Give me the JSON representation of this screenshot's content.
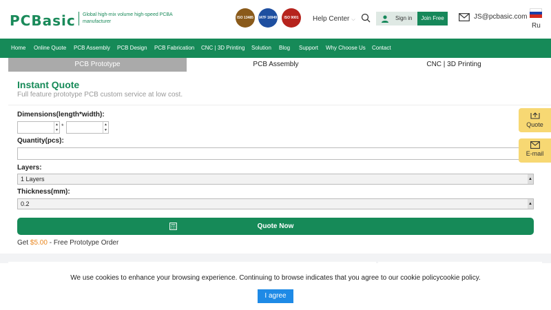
{
  "header": {
    "logo_text": "PCBasic",
    "tagline": "Global high-mix volume high-speed PCBA manufacturer",
    "certs": [
      {
        "label": "ISO 13485",
        "color": "#8a5a1a"
      },
      {
        "label": "IATF 16949",
        "color": "#1e4fa0"
      },
      {
        "label": "ISO 9001",
        "color": "#b6231d"
      }
    ],
    "help_center": "Help Center",
    "sign_in": "Sign in",
    "join_free": "Join Free",
    "email": "JS@pcbasic.com",
    "language": "Ru"
  },
  "nav": {
    "items": [
      "Home",
      "Online Quote",
      "PCB Assembly",
      "PCB Design",
      "PCB Fabrication",
      "CNC | 3D Printing",
      "Solution",
      "Blog",
      "Support",
      "Why Choose Us",
      "Contact"
    ]
  },
  "tabs": [
    "PCB Prototype",
    "PCB Assembly",
    "CNC | 3D Printing"
  ],
  "form": {
    "title": "Instant Quote",
    "subtitle": "Full feature prototype PCB custom service at low cost.",
    "dimensions_label": "Dimensions(length*width):",
    "dimension_separator": "*",
    "quantity_label": "Quantity(pcs):",
    "layers_label": "Layers:",
    "layers_value": "1 Layers",
    "thickness_label": "Thickness(mm):",
    "thickness_value": "0.2",
    "submit_label": "Quote Now",
    "promo_prefix": "Get",
    "promo_price": "$5.00",
    "promo_suffix": "- Free Prototype Order"
  },
  "side": {
    "quote_label": "Quote",
    "email_label": "E-mail"
  },
  "cookie": {
    "text": "We use cookies to enhance your browsing experience. Continuing to browse indicates that you agree to our cookie policycookie policy.",
    "agree_label": "I agree"
  },
  "colors": {
    "brand_green": "#168a58",
    "accent_yellow": "#f7d873",
    "price_orange": "#e9861e",
    "agree_blue": "#1e8ae6"
  }
}
